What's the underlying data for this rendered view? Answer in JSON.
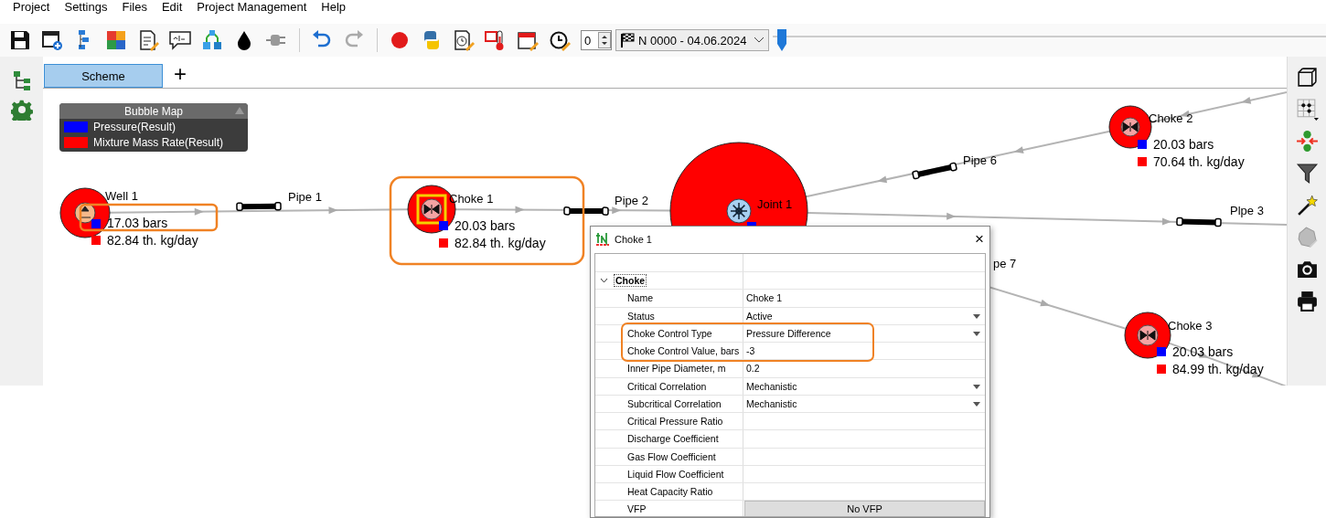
{
  "menu": [
    "Project",
    "Settings",
    "Files",
    "Edit",
    "Project Management",
    "Help"
  ],
  "toolbar": {
    "spinner": "0",
    "dropdown": "N 0000 - 04.06.2024",
    "timeline": {
      "level": 0
    }
  },
  "tabs": [
    {
      "label": "Scheme",
      "selected": true
    }
  ],
  "add_tab": "+",
  "legend": {
    "title": "Bubble Map",
    "items": [
      {
        "label": "Pressure(Result)",
        "color": "#0000ff"
      },
      {
        "label": "Mixture Mass Rate(Result)",
        "color": "#ff0000"
      }
    ]
  },
  "nodes": [
    {
      "kind": "well",
      "name": "Well 1",
      "pressure": "17.03 bars",
      "rate": "82.84 th. kg/day",
      "selected": false,
      "highlighted": true
    },
    {
      "kind": "choke",
      "name": "Choke 1",
      "pressure": "20.03 bars",
      "rate": "82.84 th. kg/day",
      "selected": true,
      "highlighted": true
    },
    {
      "kind": "joint",
      "name": "Joint 1",
      "selected": false,
      "highlighted": false
    },
    {
      "kind": "choke",
      "name": "Choke 2",
      "pressure": "20.03 bars",
      "rate": "70.64 th. kg/day",
      "selected": false,
      "highlighted": false
    },
    {
      "kind": "choke",
      "name": "Choke  3",
      "pressure": "20.03 bars",
      "rate": "84.99 th. kg/day",
      "selected": false,
      "highlighted": false
    }
  ],
  "pipes": [
    {
      "label": "Pipe 1"
    },
    {
      "label": "Pipe 2"
    },
    {
      "label": "Plpe 3"
    },
    {
      "label": "Pipe 6"
    },
    {
      "label": "pe 7"
    }
  ],
  "dialog": {
    "title": "Choke 1",
    "close": "×",
    "group": {
      "label": "Choke",
      "expanded": true
    },
    "rows": [
      {
        "label": "Name",
        "value": "Choke 1",
        "kind": "text",
        "highlight": false
      },
      {
        "label": "Status",
        "value": "Active",
        "kind": "dropdown",
        "highlight": false
      },
      {
        "label": "Choke Control Type",
        "value": "Pressure Difference",
        "kind": "dropdown",
        "highlight": true
      },
      {
        "label": "Choke Control Value, bars",
        "value": "-3",
        "kind": "text",
        "highlight": true
      },
      {
        "label": "Inner Pipe Diameter, m",
        "value": "0.2",
        "kind": "text",
        "highlight": false
      },
      {
        "label": "Critical Correlation",
        "value": "Mechanistic",
        "kind": "dropdown",
        "highlight": false
      },
      {
        "label": "Subcritical Correlation",
        "value": "Mechanistic",
        "kind": "dropdown",
        "highlight": false
      },
      {
        "label": "Critical Pressure Ratio",
        "kind": "text",
        "highlight": false
      },
      {
        "label": "Discharge Coefficient",
        "kind": "text",
        "highlight": false
      },
      {
        "label": "Gas Flow Coefficient",
        "kind": "text",
        "highlight": false
      },
      {
        "label": "Liquid Flow Coefficient",
        "kind": "text",
        "highlight": false
      },
      {
        "label": "Heat Capacity Ratio",
        "kind": "text",
        "highlight": false
      },
      {
        "label": "VFP",
        "value": "No VFP",
        "kind": "button",
        "highlight": false
      }
    ]
  }
}
